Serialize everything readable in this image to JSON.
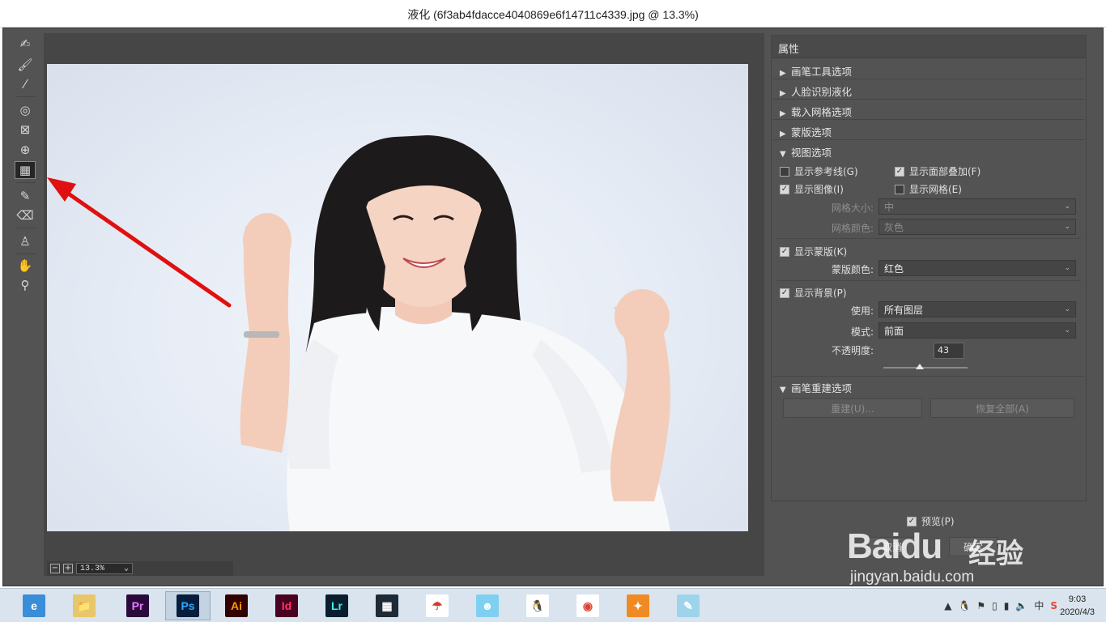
{
  "window": {
    "title": "液化 (6f3ab4fdacce4040869e6f14711c4339.jpg @ 13.3%)"
  },
  "tools": [
    {
      "name": "forward-warp-tool-icon",
      "glyph": "✍"
    },
    {
      "name": "reconstruct-tool-icon",
      "glyph": "🖌"
    },
    {
      "name": "smooth-tool-icon",
      "glyph": "⁄"
    },
    {
      "name": "twirl-tool-icon",
      "glyph": "◎"
    },
    {
      "name": "pucker-tool-icon",
      "glyph": "⊠"
    },
    {
      "name": "bloat-tool-icon",
      "glyph": "⊕"
    },
    {
      "name": "push-left-tool-icon",
      "glyph": "▦"
    },
    {
      "name": "freeze-mask-tool-icon",
      "glyph": "✎"
    },
    {
      "name": "thaw-mask-tool-icon",
      "glyph": "⌫"
    },
    {
      "name": "face-tool-icon",
      "glyph": "♙"
    },
    {
      "name": "hand-tool-icon",
      "glyph": "✋"
    },
    {
      "name": "zoom-tool-icon",
      "glyph": "⚲"
    }
  ],
  "zoom": {
    "minus": "−",
    "plus": "+",
    "value": "13.3%",
    "chevron": "⌄"
  },
  "panel": {
    "header": "属性",
    "sections": {
      "brush_tool": "画笔工具选项",
      "face_aware": "人脸识别液化",
      "load_mesh": "载入网格选项",
      "mask": "蒙版选项",
      "view": "视图选项",
      "brush_reconstruct": "画笔重建选项"
    },
    "view": {
      "show_guides": "显示参考线(G)",
      "show_face_overlay": "显示面部叠加(F)",
      "show_image": "显示图像(I)",
      "show_mesh": "显示网格(E)",
      "mesh_size_label": "网格大小:",
      "mesh_size_value": "中",
      "mesh_color_label": "网格颜色:",
      "mesh_color_value": "灰色",
      "show_mask": "显示蒙版(K)",
      "mask_color_label": "蒙版颜色:",
      "mask_color_value": "红色",
      "show_backdrop": "显示背景(P)",
      "use_label": "使用:",
      "use_value": "所有图层",
      "mode_label": "模式:",
      "mode_value": "前面",
      "opacity_label": "不透明度:",
      "opacity_value": "43",
      "opacity_fraction": 0.43
    },
    "reconstruct_button": "重建(U)...",
    "restore_all_button": "恢复全部(A)"
  },
  "bottom": {
    "preview": "预览(P)",
    "cancel": "取消",
    "ok": "确定"
  },
  "watermark": {
    "brand": "Baidu",
    "cn": "经验",
    "url": "jingyan.baidu.com"
  },
  "taskbar": {
    "apps": [
      {
        "name": "browser-360",
        "label": "e",
        "bg": "#3a8ed8",
        "fg": "#ffffff"
      },
      {
        "name": "file-explorer",
        "label": "📁",
        "bg": "#e8c66a",
        "fg": "#333333"
      },
      {
        "name": "premiere-pro",
        "label": "Pr",
        "bg": "#2a0a3b",
        "fg": "#e77bff"
      },
      {
        "name": "photoshop",
        "label": "Ps",
        "bg": "#061e3b",
        "fg": "#31a8ff"
      },
      {
        "name": "illustrator",
        "label": "Ai",
        "bg": "#330000",
        "fg": "#ff9a00"
      },
      {
        "name": "indesign",
        "label": "Id",
        "bg": "#49021f",
        "fg": "#ff3366"
      },
      {
        "name": "lightroom",
        "label": "Lr",
        "bg": "#0a1f2e",
        "fg": "#3df0f0"
      },
      {
        "name": "video-player",
        "label": "▦",
        "bg": "#1e2a36",
        "fg": "#ffffff"
      },
      {
        "name": "app-umbrella",
        "label": "☂",
        "bg": "#ffffff",
        "fg": "#d63a2a"
      },
      {
        "name": "app-mascot",
        "label": "☻",
        "bg": "#7fd0f0",
        "fg": "#ffffff"
      },
      {
        "name": "qq",
        "label": "🐧",
        "bg": "#ffffff",
        "fg": "#000000"
      },
      {
        "name": "chrome",
        "label": "◉",
        "bg": "#ffffff",
        "fg": "#db4437"
      },
      {
        "name": "app-firefox",
        "label": "✦",
        "bg": "#f08a24",
        "fg": "#ffffff"
      },
      {
        "name": "app-notepad",
        "label": "✎",
        "bg": "#9ed3ec",
        "fg": "#ffffff"
      }
    ],
    "tray": {
      "up": "▲",
      "ime": "中",
      "sogou": "S"
    },
    "time": "9:03",
    "date": "2020/4/3"
  },
  "colors": {
    "panel_bg": "#535353",
    "arrow": "#e01010"
  }
}
